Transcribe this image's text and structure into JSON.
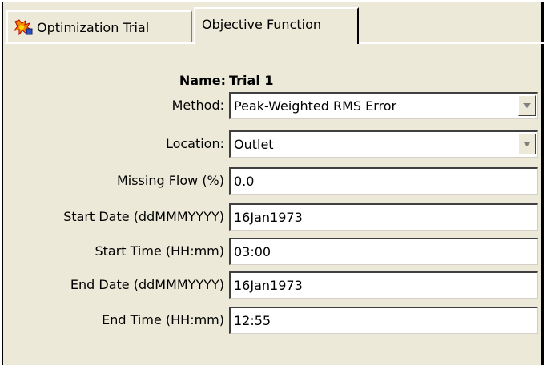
{
  "tabs": [
    {
      "label": "Optimization Trial",
      "icon": "optimization-trial-icon"
    },
    {
      "label": "Objective Function"
    }
  ],
  "form": {
    "name_label": "Name:",
    "name_value": "Trial 1",
    "method": {
      "label": "Method:",
      "value": "Peak-Weighted RMS Error"
    },
    "location": {
      "label": "Location:",
      "value": "Outlet"
    },
    "missing_flow": {
      "label": "Missing Flow (%)",
      "value": "0.0"
    },
    "start_date": {
      "label": "Start Date (ddMMMYYYY)",
      "value": "16Jan1973"
    },
    "start_time": {
      "label": "Start Time (HH:mm)",
      "value": "03:00"
    },
    "end_date": {
      "label": "End Date (ddMMMYYYY)",
      "value": "16Jan1973"
    },
    "end_time": {
      "label": "End Time (HH:mm)",
      "value": "12:55"
    }
  }
}
